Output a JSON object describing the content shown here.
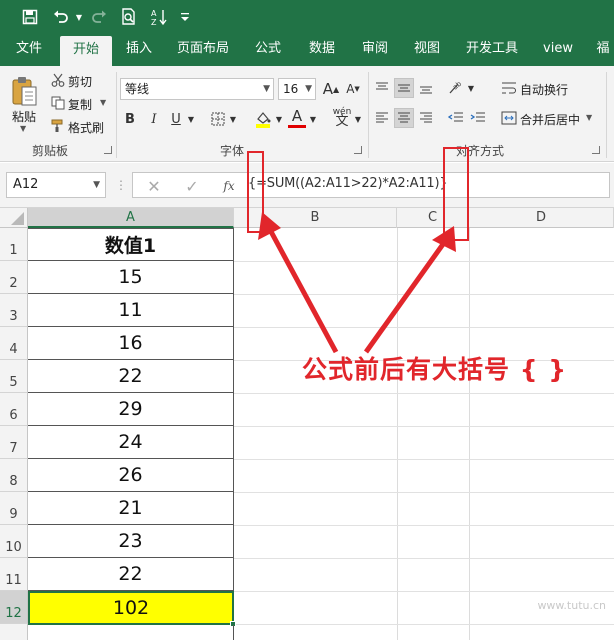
{
  "quick_access": {
    "icons": [
      "save-icon",
      "undo-icon",
      "redo-icon",
      "print-preview-icon",
      "sort-icon",
      "customize-icon"
    ]
  },
  "ribbon": {
    "tabs": [
      "文件",
      "开始",
      "插入",
      "页面布局",
      "公式",
      "数据",
      "审阅",
      "视图",
      "开发工具",
      "view",
      "福"
    ],
    "active_tab": "开始",
    "clipboard": {
      "paste": "粘贴",
      "cut": "剪切",
      "copy": "复制",
      "format_painter": "格式刷",
      "group": "剪贴板"
    },
    "font": {
      "name": "等线",
      "size": "16",
      "grow": "A",
      "shrink": "A",
      "bold": "B",
      "italic": "I",
      "underline": "U",
      "font_color": "A",
      "phonetic": "wén",
      "group": "字体"
    },
    "alignment": {
      "wrap_text": "自动换行",
      "merge_center": "合并后居中",
      "group": "对齐方式"
    }
  },
  "formula_bar": {
    "name_box": "A12",
    "fx": "fx",
    "formula": "{=SUM((A2:A11>22)*A2:A11)}"
  },
  "grid": {
    "columns": [
      "A",
      "B",
      "C",
      "D"
    ],
    "active_column": "A",
    "rows": [
      "1",
      "2",
      "3",
      "4",
      "5",
      "6",
      "7",
      "8",
      "9",
      "10",
      "11",
      "12"
    ],
    "active_row": "12",
    "column_a": [
      "数值1",
      "15",
      "11",
      "16",
      "22",
      "29",
      "24",
      "26",
      "21",
      "23",
      "22",
      "102"
    ]
  },
  "annotation": {
    "text": "公式前后有大括号 { }",
    "color": "#e1262b"
  },
  "watermark": "www.tutu.cn",
  "colors": {
    "brand": "#217346",
    "highlight": "#ffff00"
  }
}
